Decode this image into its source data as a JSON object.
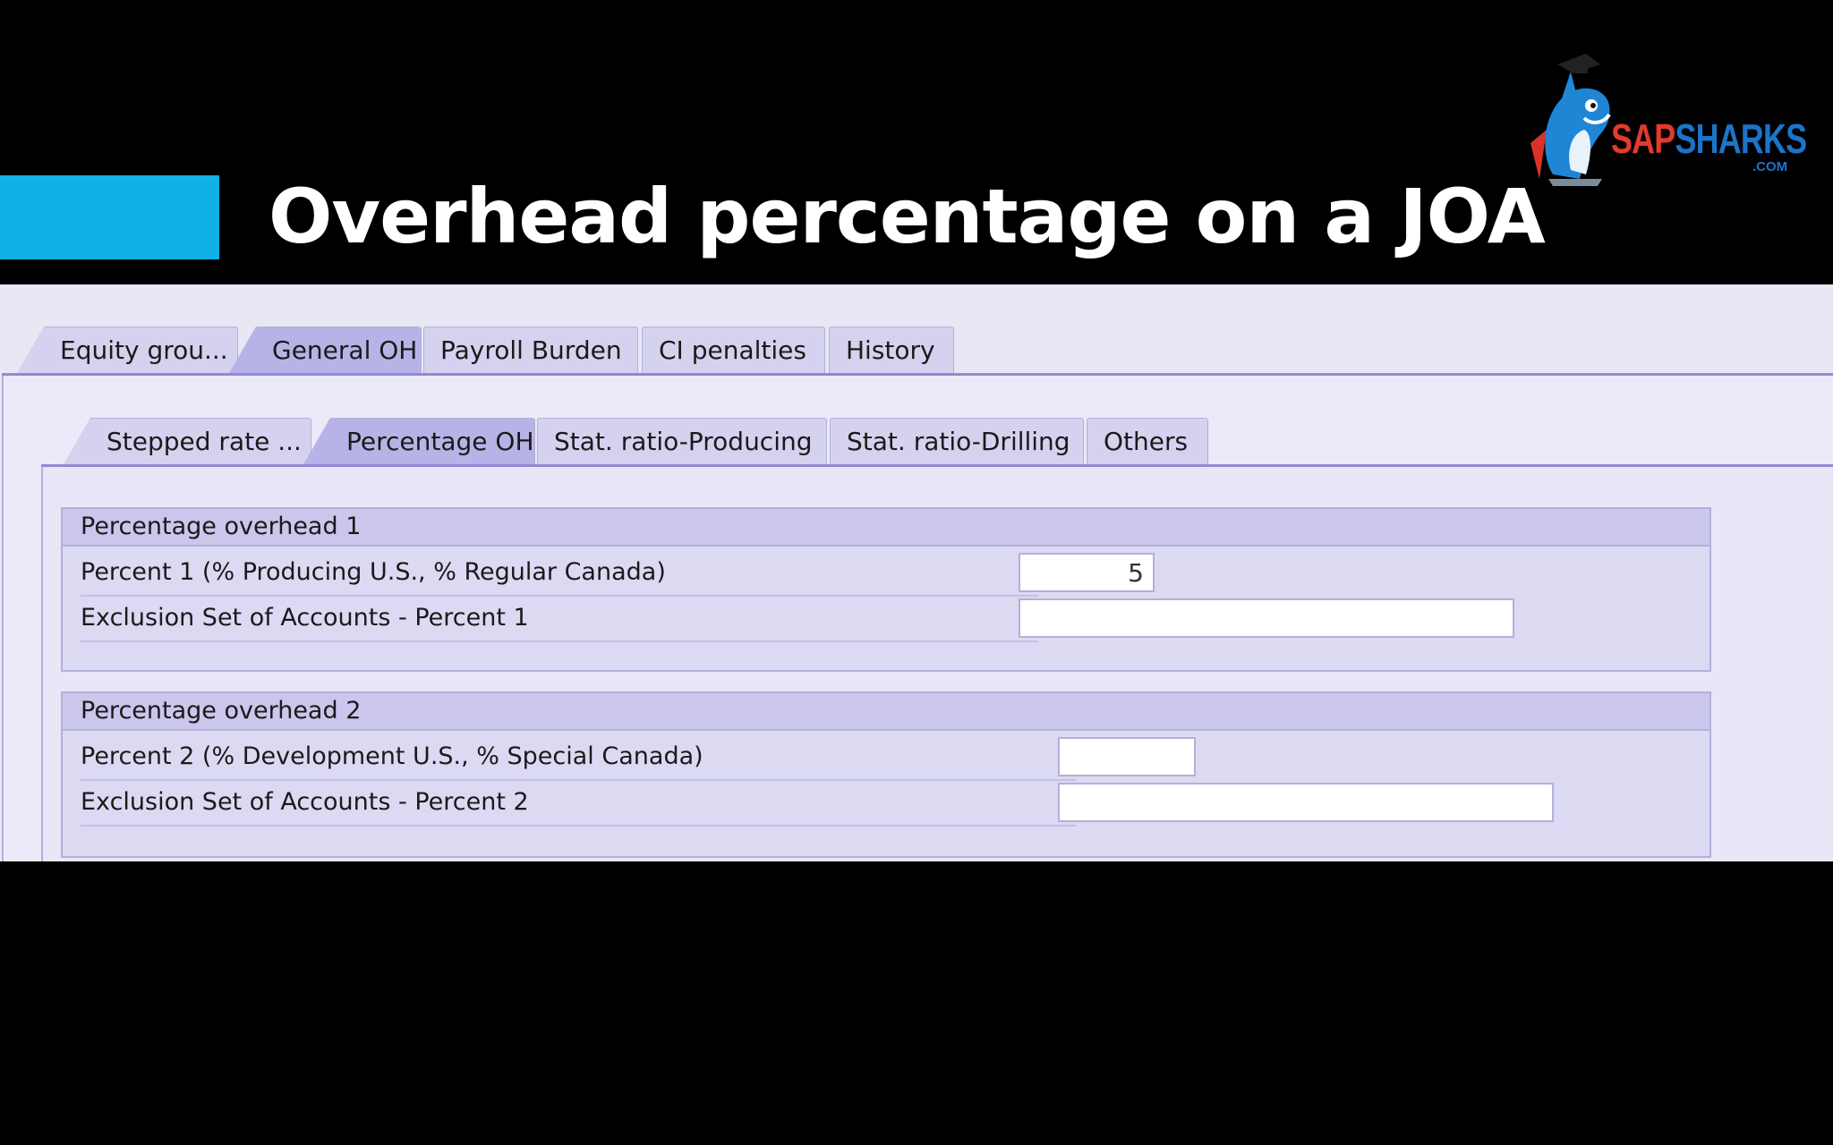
{
  "slide": {
    "title": "Overhead percentage on a JOA",
    "logo": {
      "sap": "SAP",
      "sharks": "SHARKS",
      "com": ".COM",
      "icon": "shark-mascot-icon"
    },
    "accent_color": "#0fb1e6"
  },
  "outer_tabs": [
    {
      "label": "Equity grou...",
      "active": false
    },
    {
      "label": "General OH",
      "active": true
    },
    {
      "label": "Payroll Burden",
      "active": false
    },
    {
      "label": "CI penalties",
      "active": false
    },
    {
      "label": "History",
      "active": false
    }
  ],
  "inner_tabs": [
    {
      "label": "Stepped rate ...",
      "active": false
    },
    {
      "label": "Percentage OH",
      "active": true
    },
    {
      "label": "Stat. ratio-Producing",
      "active": false
    },
    {
      "label": "Stat. ratio-Drilling",
      "active": false
    },
    {
      "label": "Others",
      "active": false
    }
  ],
  "groups": [
    {
      "title": "Percentage overhead 1",
      "rows": [
        {
          "label": "Percent 1 (% Producing U.S., % Regular Canada)",
          "value": "5"
        },
        {
          "label": "Exclusion Set of Accounts - Percent 1",
          "value": ""
        }
      ]
    },
    {
      "title": "Percentage overhead 2",
      "rows": [
        {
          "label": "Percent 2 (% Development U.S., % Special Canada)",
          "value": ""
        },
        {
          "label": "Exclusion Set of Accounts - Percent 2",
          "value": ""
        }
      ]
    }
  ]
}
